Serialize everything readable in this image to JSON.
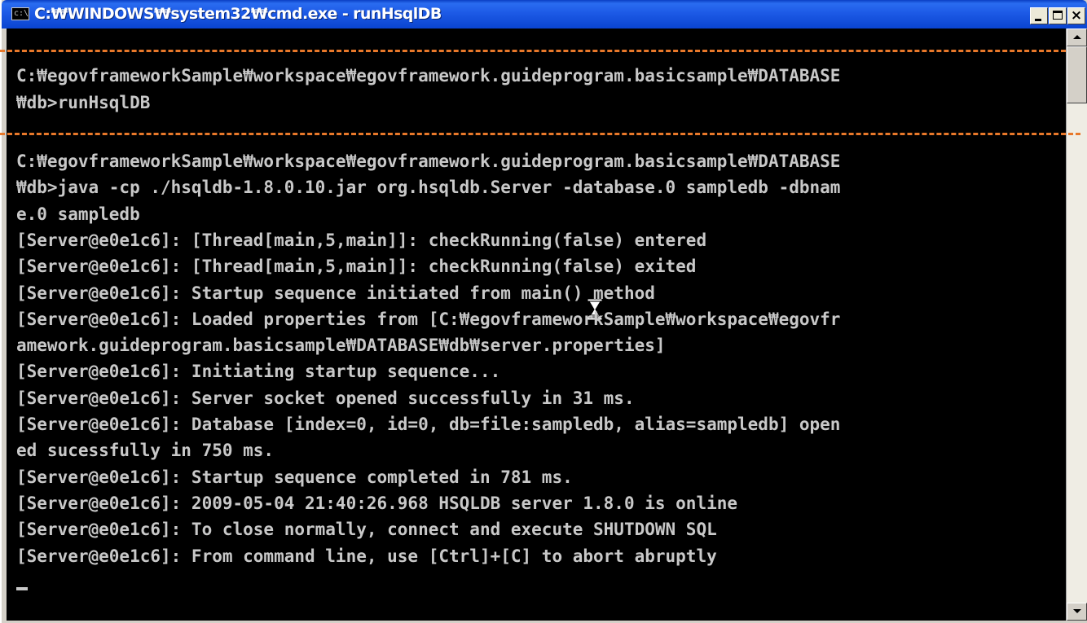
{
  "window": {
    "title": "C:₩WINDOWS₩system32₩cmd.exe - runHsqlDB",
    "icon_text": "c:\\",
    "buttons": {
      "minimize": "minimize-icon",
      "maximize": "maximize-icon",
      "close_glyph": "×"
    }
  },
  "console": {
    "lines": [
      "C:₩egovframeworkSample₩workspace₩egovframework.guideprogram.basicsample₩DATABASE",
      "₩db>runHsqlDB",
      "",
      "C:₩egovframeworkSample₩workspace₩egovframework.guideprogram.basicsample₩DATABASE",
      "₩db>java -cp ./hsqldb-1.8.0.10.jar org.hsqldb.Server -database.0 sampledb -dbnam",
      "e.0 sampledb",
      "[Server@e0e1c6]: [Thread[main,5,main]]: checkRunning(false) entered",
      "[Server@e0e1c6]: [Thread[main,5,main]]: checkRunning(false) exited",
      "[Server@e0e1c6]: Startup sequence initiated from main() method",
      "[Server@e0e1c6]: Loaded properties from [C:₩egovframeworkSample₩workspace₩egovfr",
      "amework.guideprogram.basicsample₩DATABASE₩db₩server.properties]",
      "[Server@e0e1c6]: Initiating startup sequence...",
      "[Server@e0e1c6]: Server socket opened successfully in 31 ms.",
      "[Server@e0e1c6]: Database [index=0, id=0, db=file:sampledb, alias=sampledb] open",
      "ed sucessfully in 750 ms.",
      "[Server@e0e1c6]: Startup sequence completed in 781 ms.",
      "[Server@e0e1c6]: 2009-05-04 21:40:26.968 HSQLDB server 1.8.0 is online",
      "[Server@e0e1c6]: To close normally, connect and execute SHUTDOWN SQL",
      "[Server@e0e1c6]: From command line, use [Ctrl]+[C] to abort abruptly"
    ]
  },
  "colors": {
    "titlebar": "#1d5ae6",
    "console_bg": "#000000",
    "console_text": "#c8c8c8",
    "highlight": "#e8782a"
  },
  "icons": {
    "cursor": "hourglass-icon",
    "scroll_up": "arrow-up-icon",
    "scroll_down": "arrow-down-icon"
  }
}
